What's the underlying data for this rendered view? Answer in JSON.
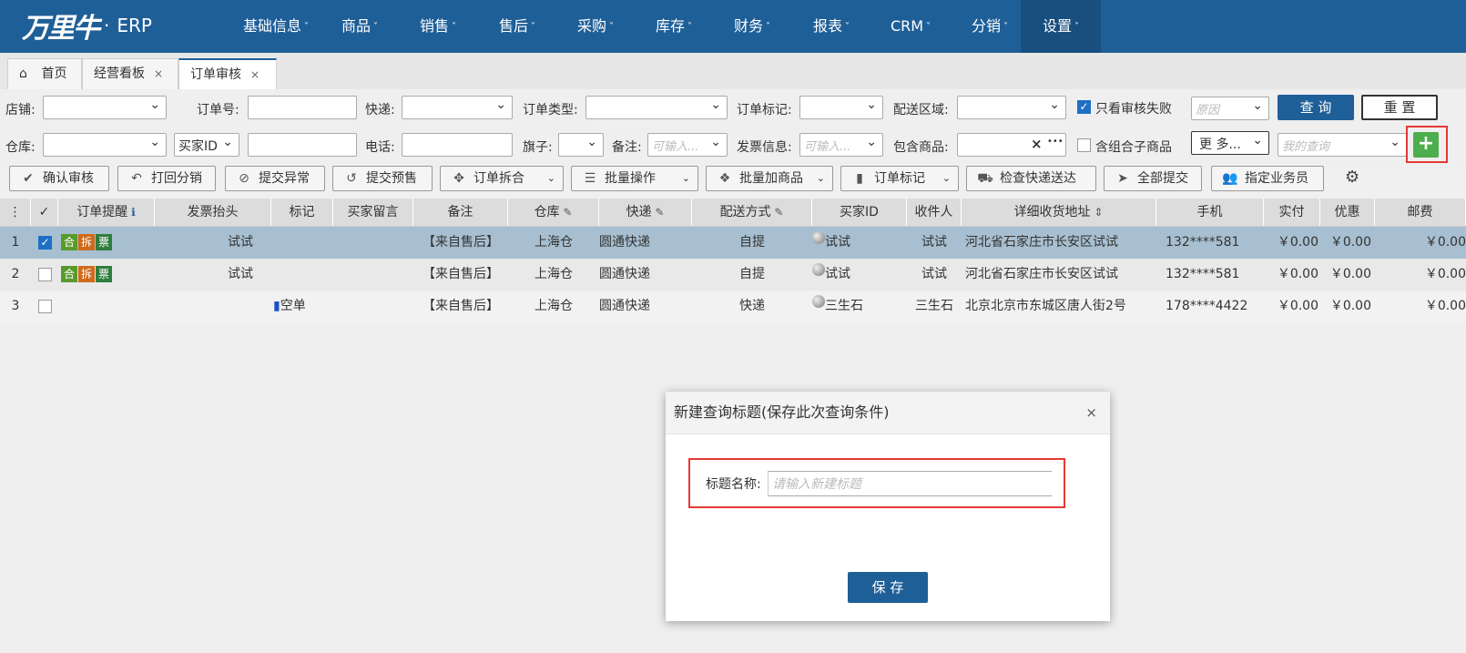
{
  "colors": {
    "nav_bg": "#1f5f98",
    "primary": "#1f5f98",
    "add_green": "#4cae4c",
    "highlight_red": "#e53935",
    "selected_row": "#a7bfd0"
  },
  "brand": {
    "logo_text": "万里牛",
    "dot": "·",
    "app": "ERP"
  },
  "nav": {
    "items": [
      "基础信息",
      "商品",
      "销售",
      "售后",
      "采购",
      "库存",
      "财务",
      "报表",
      "CRM",
      "分销",
      "设置"
    ],
    "active": "设置",
    "caret": "˅"
  },
  "tabs": [
    {
      "label": "首页",
      "icon": "home-icon"
    },
    {
      "label": "经营看板",
      "close": "×"
    },
    {
      "label": "订单审核",
      "close": "×",
      "active": true
    }
  ],
  "filters": {
    "shop": "店铺:",
    "order_no": "订单号:",
    "express": "快递:",
    "order_type": "订单类型:",
    "order_mark": "订单标记:",
    "delivery_area": "配送区域:",
    "only_failed": "只看审核失败",
    "reason_placeholder": "原因",
    "query": "查 询",
    "reset": "重 置",
    "warehouse": "仓库:",
    "buyer_id_select": "买家ID",
    "phone": "电话:",
    "flag": "旗子:",
    "remark": "备注:",
    "remark_placeholder": "可输入...",
    "invoice": "发票信息:",
    "invoice_placeholder": "可输入...",
    "contains_goods": "包含商品:",
    "clear": "×",
    "more_dots": "•••",
    "combo_child": "含组合子商品",
    "more": "更 多...",
    "my_query_placeholder": "我的查询",
    "add": "+"
  },
  "toolbar": [
    {
      "label": "确认审核",
      "icon": "check-icon"
    },
    {
      "label": "打回分销",
      "icon": "reply-icon"
    },
    {
      "label": "提交异常",
      "icon": "ban-icon"
    },
    {
      "label": "提交预售",
      "icon": "history-icon"
    },
    {
      "label": "订单拆合",
      "icon": "move-icon",
      "dropdown": true
    },
    {
      "label": "批量操作",
      "icon": "list-icon",
      "dropdown": true
    },
    {
      "label": "批量加商品",
      "icon": "cubes-icon",
      "dropdown": true
    },
    {
      "label": "订单标记",
      "icon": "bookmark-icon",
      "dropdown": true
    },
    {
      "label": "检查快递送达",
      "icon": "truck-icon"
    },
    {
      "label": "全部提交",
      "icon": "send-icon"
    },
    {
      "label": "指定业务员",
      "icon": "users-icon"
    }
  ],
  "table": {
    "headers": [
      "⋮",
      "✓",
      "订单提醒",
      "发票抬头",
      "标记",
      "买家留言",
      "备注",
      "仓库",
      "快递",
      "配送方式",
      "买家ID",
      "收件人",
      "详细收货地址",
      "手机",
      "实付",
      "优惠",
      "邮费"
    ],
    "rows": [
      {
        "no": "1",
        "checked": true,
        "tags": [
          "合",
          "拆",
          "票"
        ],
        "invoice": "试试",
        "mark": "",
        "msg": "",
        "remark": "【来自售后】",
        "warehouse": "上海仓",
        "express": "圆通快递",
        "delivery": "自提",
        "buyer": "试试",
        "receiver": "试试",
        "address": "河北省石家庄市长安区试试",
        "phone": "132****581",
        "paid": "￥0.00",
        "discount": "￥0.00",
        "postage": "￥0.00"
      },
      {
        "no": "2",
        "checked": false,
        "tags": [
          "合",
          "拆",
          "票"
        ],
        "invoice": "试试",
        "mark": "",
        "msg": "",
        "remark": "【来自售后】",
        "warehouse": "上海仓",
        "express": "圆通快递",
        "delivery": "自提",
        "buyer": "试试",
        "receiver": "试试",
        "address": "河北省石家庄市长安区试试",
        "phone": "132****581",
        "paid": "￥0.00",
        "discount": "￥0.00",
        "postage": "￥0.00"
      },
      {
        "no": "3",
        "checked": false,
        "tags": [],
        "invoice": "",
        "mark": "空单",
        "msg": "",
        "remark": "【来自售后】",
        "warehouse": "上海仓",
        "express": "圆通快递",
        "delivery": "快递",
        "buyer": "三生石",
        "receiver": "三生石",
        "address": "北京北京市东城区唐人街2号",
        "phone": "178****4422",
        "paid": "￥0.00",
        "discount": "￥0.00",
        "postage": "￥0.00"
      }
    ]
  },
  "modal": {
    "title": "新建查询标题(保存此次查询条件)",
    "close": "×",
    "field_label": "标题名称:",
    "field_placeholder": "请输入新建标题",
    "save": "保 存"
  }
}
